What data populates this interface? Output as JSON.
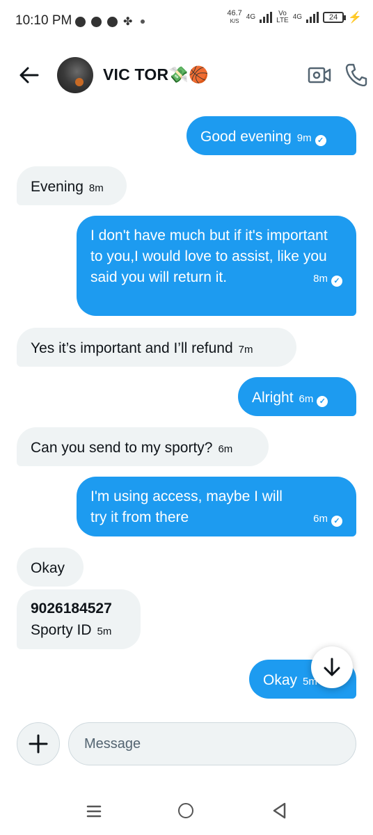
{
  "status_bar": {
    "time": "10:10 PM",
    "net_speed_value": "46.7",
    "net_speed_unit": "K/S",
    "sig1_label": "4G",
    "sig2_label_top": "Vo",
    "sig2_label_bottom": "LTE",
    "sig3_label": "4G",
    "battery": "24"
  },
  "header": {
    "contact_name": "VIC TOR💸🏀"
  },
  "messages": [
    {
      "direction": "out",
      "text": "Good evening",
      "time": "9m"
    },
    {
      "direction": "in",
      "text": "Evening",
      "time": "8m"
    },
    {
      "direction": "out",
      "text": "I don't have much but if it's important to you,I would love to assist, like you said you will return it.",
      "time": "8m"
    },
    {
      "direction": "in",
      "text": "Yes it’s important and I’ll refund",
      "time": "7m"
    },
    {
      "direction": "out",
      "text": "Alright",
      "time": "6m"
    },
    {
      "direction": "in",
      "text": "Can you send to my sporty?",
      "time": "6m"
    },
    {
      "direction": "out",
      "text": "I'm using access, maybe I will try it from there",
      "time": "6m"
    },
    {
      "direction": "in",
      "text": "Okay",
      "time": ""
    },
    {
      "direction": "in",
      "text_bold": "9026184527",
      "text": "Sporty ID",
      "time": "5m"
    },
    {
      "direction": "out",
      "text": "Okay",
      "time": "5m"
    }
  ],
  "composer": {
    "placeholder": "Message"
  }
}
